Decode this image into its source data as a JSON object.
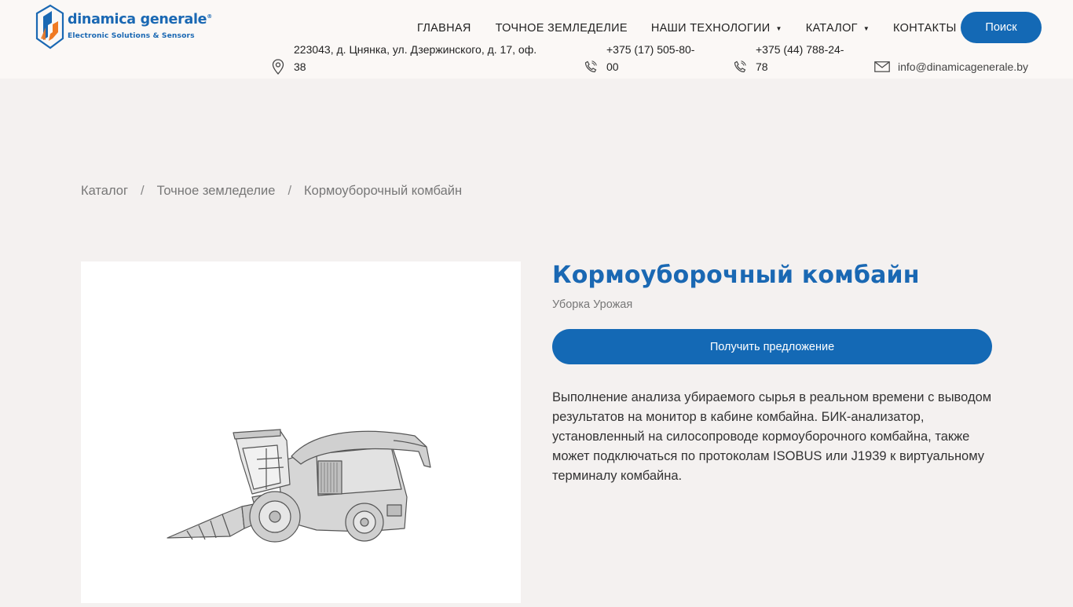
{
  "header": {
    "logo": {
      "name": "dinamica generale",
      "registered": "®",
      "tagline": "Electronic Solutions & Sensors"
    },
    "nav": [
      {
        "label": "ГЛАВНАЯ",
        "dropdown": false
      },
      {
        "label": "ТОЧНОЕ ЗЕМЛЕДЕЛИЕ",
        "dropdown": false
      },
      {
        "label": "НАШИ ТЕХНОЛОГИИ",
        "dropdown": true
      },
      {
        "label": "КАТАЛОГ",
        "dropdown": true
      },
      {
        "label": "КОНТАКТЫ",
        "dropdown": false
      }
    ],
    "search_label": "Поиск",
    "contacts": {
      "address_line1": "223043, д. Цнянка, ул. Дзержинского, д. 17, оф.",
      "address_line2": "38",
      "phone1_line1": "+375 (17) 505-80-",
      "phone1_line2": "00",
      "phone2_line1": "+375 (44) 788-24-",
      "phone2_line2": "78",
      "email": "info@dinamicagenerale.by"
    }
  },
  "breadcrumb": {
    "items": [
      "Каталог",
      "Точное земледелие",
      "Кормоуборочный комбайн"
    ],
    "separator": "/"
  },
  "product": {
    "title": "Кормоуборочный комбайн",
    "subtitle": "Уборка Урожая",
    "offer_button": "Получить предложение",
    "description": "Выполнение анализа убираемого сырья в реальном времени с выводом результатов на монитор в кабине комбайна. БИК-анализатор, установленный на силосопроводе кормоуборочного комбайна, также может подключаться по протоколам ISOBUS или J1939 к виртуальному терминалу комбайна."
  },
  "icons": {
    "address": "map-pin-icon",
    "phone": "phone-icon",
    "email": "envelope-icon",
    "dropdown": "caret-down-icon"
  },
  "colors": {
    "brand_blue": "#1469b5",
    "logo_orange": "#f07a23",
    "page_bg": "#f4f1f0",
    "header_bg": "#fbf8f6"
  }
}
